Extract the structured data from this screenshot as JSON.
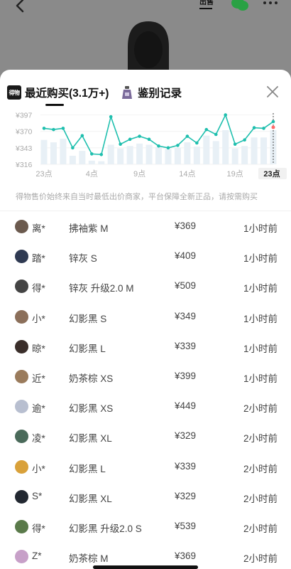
{
  "header": {
    "sell_label": "出售"
  },
  "tabs": {
    "logo_text": "得物",
    "recent_label": "最近购买(3.1万+)",
    "auth_label": "鉴别记录"
  },
  "chart_data": {
    "type": "line",
    "y_ticks": [
      "¥397",
      "¥370",
      "¥343",
      "¥316"
    ],
    "ylim": [
      316,
      400
    ],
    "x_tick_labels": [
      "23点",
      "4点",
      "9点",
      "14点",
      "19点",
      "23点"
    ],
    "selected_x_label": "23点",
    "x_hours": [
      23,
      0,
      1,
      2,
      3,
      4,
      5,
      6,
      7,
      8,
      9,
      10,
      11,
      12,
      13,
      14,
      15,
      16,
      17,
      18,
      19,
      20,
      21,
      22,
      23
    ],
    "values": [
      375,
      373,
      375,
      343,
      363,
      333,
      332,
      394,
      349,
      357,
      362,
      357,
      346,
      343,
      347,
      362,
      351,
      373,
      365,
      397,
      349,
      356,
      376,
      375,
      386
    ],
    "bar_values": [
      356,
      352,
      358,
      330,
      338,
      322,
      321,
      348,
      342,
      346,
      350,
      348,
      344,
      341,
      343,
      352,
      345,
      363,
      354,
      372,
      342,
      346,
      360,
      360,
      372
    ],
    "line_color": "#1fbfae",
    "bar_color": "#e8f0f6",
    "grid": true
  },
  "disclaimer": "得物售价始终来自当时最低出价商家，平台保障全新正品，请按需购买",
  "purchases": [
    {
      "user": "离*",
      "variant": "拂袖紫 M",
      "price": "¥369",
      "time": "1小时前"
    },
    {
      "user": "踏*",
      "variant": "锌灰 S",
      "price": "¥409",
      "time": "1小时前"
    },
    {
      "user": "得*",
      "variant": "锌灰 升级2.0 M",
      "price": "¥509",
      "time": "1小时前"
    },
    {
      "user": "小*",
      "variant": "幻影黑 S",
      "price": "¥349",
      "time": "1小时前"
    },
    {
      "user": "晾*",
      "variant": "幻影黑 L",
      "price": "¥339",
      "time": "1小时前"
    },
    {
      "user": "近*",
      "variant": "奶茶棕 XS",
      "price": "¥399",
      "time": "1小时前"
    },
    {
      "user": "逾*",
      "variant": "幻影黑 XS",
      "price": "¥449",
      "time": "2小时前"
    },
    {
      "user": "凌*",
      "variant": "幻影黑 XL",
      "price": "¥329",
      "time": "2小时前"
    },
    {
      "user": "小*",
      "variant": "幻影黑 L",
      "price": "¥339",
      "time": "2小时前"
    },
    {
      "user": "S*",
      "variant": "幻影黑 XL",
      "price": "¥329",
      "time": "2小时前"
    },
    {
      "user": "得*",
      "variant": "幻影黑 升级2.0 S",
      "price": "¥539",
      "time": "2小时前"
    },
    {
      "user": "Z*",
      "variant": "奶茶棕 M",
      "price": "¥369",
      "time": "2小时前"
    }
  ],
  "avatar_colors": [
    "#6b5a4e",
    "#2f3a52",
    "#444444",
    "#8b6f5a",
    "#3a2e2a",
    "#9a7b5c",
    "#b8bfd0",
    "#4a6a5a",
    "#d9a13a",
    "#222831",
    "#5a7a4a",
    "#c7a0c8"
  ]
}
